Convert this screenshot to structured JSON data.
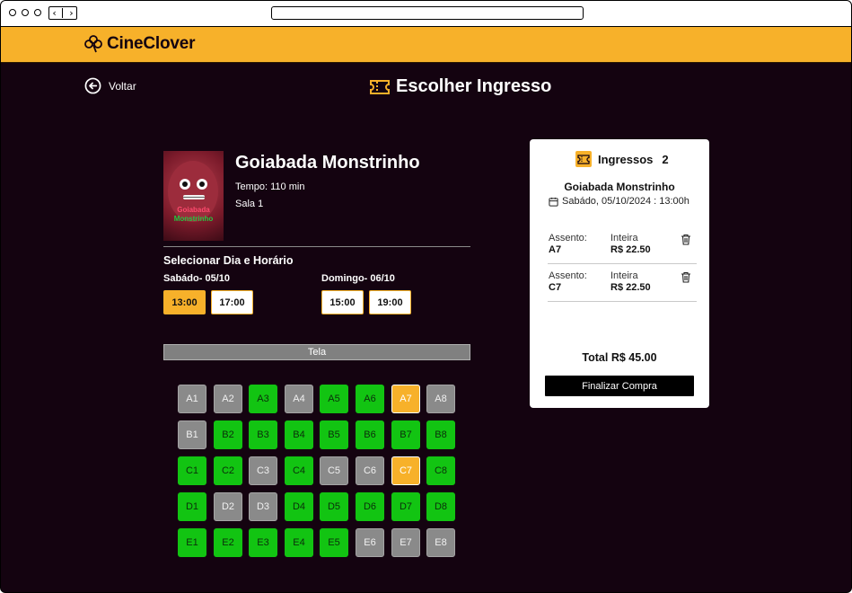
{
  "app": {
    "brand": "CineClover",
    "page_title": "Escolher Ingresso",
    "back_label": "Voltar"
  },
  "colors": {
    "accent": "#f7b12a",
    "background": "#140310",
    "available": "#12c412",
    "occupied": "#8a8a8a"
  },
  "movie": {
    "title": "Goiabada Monstrinho",
    "duration": "Tempo: 110 min",
    "room": "Sala 1",
    "poster_text_line1": "Goiabada",
    "poster_text_line2": "Monstrinho"
  },
  "schedule": {
    "section_title": "Selecionar Dia e Horário",
    "days": [
      {
        "label": "Sabádo- 05/10",
        "times": [
          "13:00",
          "17:00"
        ],
        "selected": "13:00"
      },
      {
        "label": "Domingo- 06/10",
        "times": [
          "15:00",
          "19:00"
        ],
        "selected": null
      }
    ]
  },
  "screen_label": "Tela",
  "seat_map": {
    "rows": [
      {
        "row": "A",
        "seats": [
          {
            "id": "A1",
            "status": "occupied"
          },
          {
            "id": "A2",
            "status": "occupied"
          },
          {
            "id": "A3",
            "status": "available"
          },
          {
            "id": "A4",
            "status": "occupied"
          },
          {
            "id": "A5",
            "status": "available"
          },
          {
            "id": "A6",
            "status": "available"
          },
          {
            "id": "A7",
            "status": "selected"
          },
          {
            "id": "A8",
            "status": "occupied"
          }
        ]
      },
      {
        "row": "B",
        "seats": [
          {
            "id": "B1",
            "status": "occupied"
          },
          {
            "id": "B2",
            "status": "available"
          },
          {
            "id": "B3",
            "status": "available"
          },
          {
            "id": "B4",
            "status": "available"
          },
          {
            "id": "B5",
            "status": "available"
          },
          {
            "id": "B6",
            "status": "available"
          },
          {
            "id": "B7",
            "status": "available"
          },
          {
            "id": "B8",
            "status": "available"
          }
        ]
      },
      {
        "row": "C",
        "seats": [
          {
            "id": "C1",
            "status": "available"
          },
          {
            "id": "C2",
            "status": "available"
          },
          {
            "id": "C3",
            "status": "occupied"
          },
          {
            "id": "C4",
            "status": "available"
          },
          {
            "id": "C5",
            "status": "occupied"
          },
          {
            "id": "C6",
            "status": "occupied"
          },
          {
            "id": "C7",
            "status": "selected"
          },
          {
            "id": "C8",
            "status": "available"
          }
        ]
      },
      {
        "row": "D",
        "seats": [
          {
            "id": "D1",
            "status": "available"
          },
          {
            "id": "D2",
            "status": "occupied"
          },
          {
            "id": "D3",
            "status": "occupied"
          },
          {
            "id": "D4",
            "status": "available"
          },
          {
            "id": "D5",
            "status": "available"
          },
          {
            "id": "D6",
            "status": "available"
          },
          {
            "id": "D7",
            "status": "available"
          },
          {
            "id": "D8",
            "status": "available"
          }
        ]
      },
      {
        "row": "E",
        "seats": [
          {
            "id": "E1",
            "status": "available"
          },
          {
            "id": "E2",
            "status": "available"
          },
          {
            "id": "E3",
            "status": "available"
          },
          {
            "id": "E4",
            "status": "available"
          },
          {
            "id": "E5",
            "status": "available"
          },
          {
            "id": "E6",
            "status": "occupied"
          },
          {
            "id": "E7",
            "status": "occupied"
          },
          {
            "id": "E8",
            "status": "occupied"
          }
        ]
      }
    ]
  },
  "cart": {
    "heading": "Ingressos",
    "count": "2",
    "movie_title": "Goiabada Monstrinho",
    "datetime": "Sabádo, 05/10/2024 : 13:00h",
    "tickets": [
      {
        "seat_label": "Assento:",
        "seat": "A7",
        "type": "Inteira",
        "price": "R$ 22.50"
      },
      {
        "seat_label": "Assento:",
        "seat": "C7",
        "type": "Inteira",
        "price": "R$ 22.50"
      }
    ],
    "total": "Total R$ 45.00",
    "finalize_label": "Finalizar Compra"
  }
}
